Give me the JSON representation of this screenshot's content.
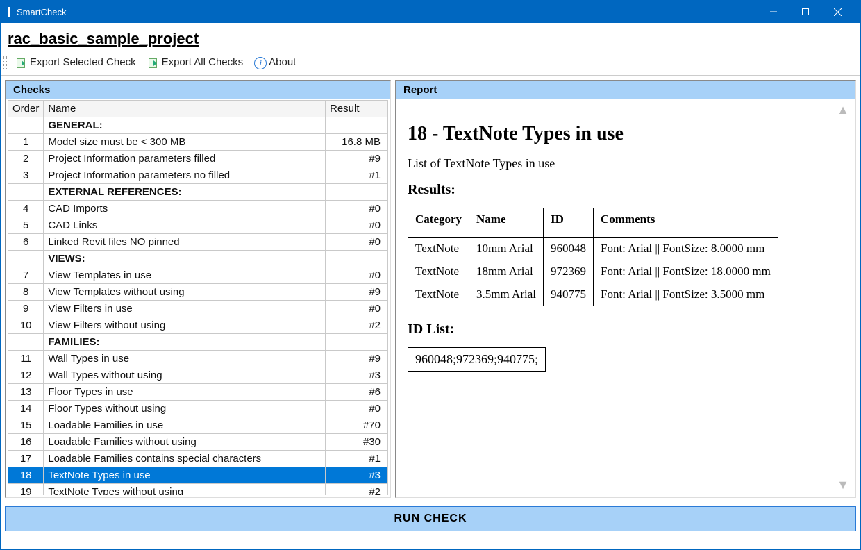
{
  "window": {
    "title": "SmartCheck"
  },
  "document": {
    "title": "rac_basic_sample_project"
  },
  "toolbar": {
    "export_selected": "Export Selected Check",
    "export_all": "Export All Checks",
    "about": "About"
  },
  "panels": {
    "checks_title": "Checks",
    "report_title": "Report"
  },
  "checks_table": {
    "columns": {
      "order": "Order",
      "name": "Name",
      "result": "Result"
    },
    "rows": [
      {
        "type": "section",
        "name": "GENERAL:"
      },
      {
        "type": "item",
        "order": "1",
        "name": "Model size must be < 300 MB",
        "result": "16.8 MB"
      },
      {
        "type": "item",
        "order": "2",
        "name": "Project Information parameters filled",
        "result": "#9"
      },
      {
        "type": "item",
        "order": "3",
        "name": "Project Information parameters no filled",
        "result": "#1"
      },
      {
        "type": "section",
        "name": "EXTERNAL REFERENCES:"
      },
      {
        "type": "item",
        "order": "4",
        "name": "CAD Imports",
        "result": "#0"
      },
      {
        "type": "item",
        "order": "5",
        "name": "CAD Links",
        "result": "#0"
      },
      {
        "type": "item",
        "order": "6",
        "name": "Linked Revit files NO pinned",
        "result": "#0"
      },
      {
        "type": "section",
        "name": "VIEWS:"
      },
      {
        "type": "item",
        "order": "7",
        "name": "View Templates in use",
        "result": "#0"
      },
      {
        "type": "item",
        "order": "8",
        "name": "View Templates without using",
        "result": "#9"
      },
      {
        "type": "item",
        "order": "9",
        "name": "View Filters in use",
        "result": "#0"
      },
      {
        "type": "item",
        "order": "10",
        "name": "View Filters without using",
        "result": "#2"
      },
      {
        "type": "section",
        "name": "FAMILIES:"
      },
      {
        "type": "item",
        "order": "11",
        "name": "Wall Types in use",
        "result": "#9"
      },
      {
        "type": "item",
        "order": "12",
        "name": "Wall Types without using",
        "result": "#3"
      },
      {
        "type": "item",
        "order": "13",
        "name": "Floor Types in use",
        "result": "#6"
      },
      {
        "type": "item",
        "order": "14",
        "name": "Floor Types without using",
        "result": "#0"
      },
      {
        "type": "item",
        "order": "15",
        "name": "Loadable Families in use",
        "result": "#70"
      },
      {
        "type": "item",
        "order": "16",
        "name": "Loadable Families without using",
        "result": "#30"
      },
      {
        "type": "item",
        "order": "17",
        "name": "Loadable Families contains special characters",
        "result": "#1"
      },
      {
        "type": "item",
        "order": "18",
        "name": "TextNote Types in use",
        "result": "#3",
        "selected": true
      },
      {
        "type": "item",
        "order": "19",
        "name": "TextNote Types without using",
        "result": "#2"
      }
    ]
  },
  "report": {
    "title": "18 - TextNote Types in use",
    "description": "List of TextNote Types in use",
    "results_heading": "Results:",
    "columns": {
      "category": "Category",
      "name": "Name",
      "id": "ID",
      "comments": "Comments"
    },
    "rows": [
      {
        "category": "TextNote",
        "name": "10mm Arial",
        "id": "960048",
        "comments": "Font: Arial || FontSize: 8.0000 mm"
      },
      {
        "category": "TextNote",
        "name": "18mm Arial",
        "id": "972369",
        "comments": "Font: Arial || FontSize: 18.0000 mm"
      },
      {
        "category": "TextNote",
        "name": "3.5mm Arial",
        "id": "940775",
        "comments": "Font: Arial || FontSize: 3.5000 mm"
      }
    ],
    "idlist_heading": "ID List:",
    "idlist": "960048;972369;940775;"
  },
  "footer": {
    "run_label": "RUN CHECK"
  }
}
